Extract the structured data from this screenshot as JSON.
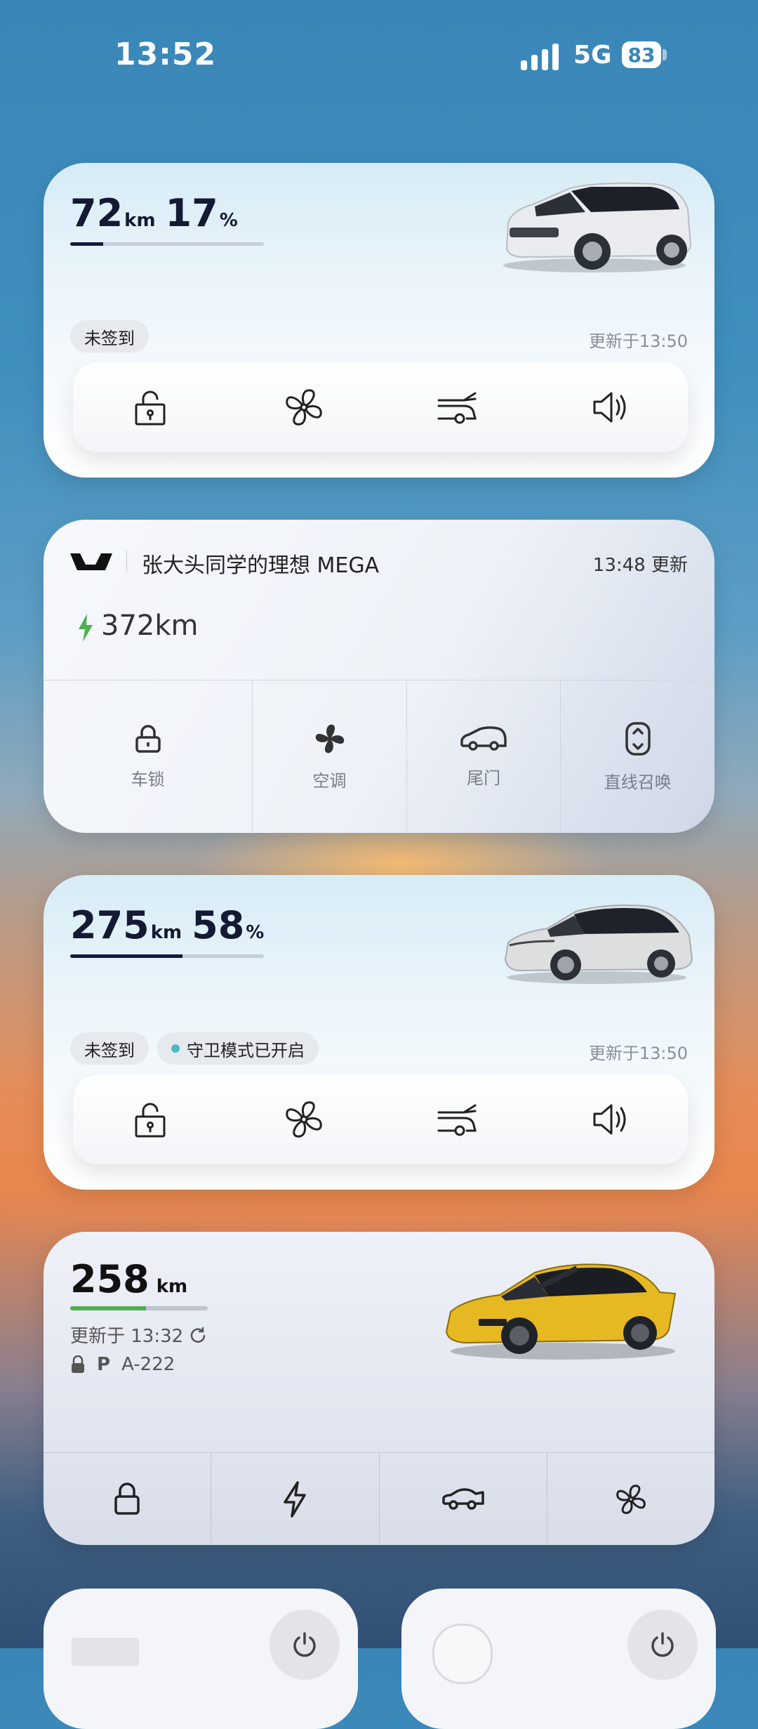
{
  "status_bar": {
    "time": "13:52",
    "network": "5G",
    "battery": "83"
  },
  "cards": [
    {
      "range_value": "72",
      "range_unit": "km",
      "battery_value": "17",
      "battery_unit": "%",
      "battery_level_fraction": 0.17,
      "badge": "未签到",
      "updated": "更新于13:50",
      "controls": [
        "lock-icon",
        "fan-icon",
        "tailgate-icon",
        "horn-icon"
      ]
    },
    {
      "title": "张大头同学的理想 MEGA",
      "updated": "13:48 更新",
      "range": "372km",
      "controls": [
        {
          "label": "车锁",
          "icon": "lock-icon"
        },
        {
          "label": "空调",
          "icon": "fan-icon"
        },
        {
          "label": "尾门",
          "icon": "car-rear-icon"
        },
        {
          "label": "直线召唤",
          "icon": "summon-icon"
        }
      ]
    },
    {
      "range_value": "275",
      "range_unit": "km",
      "battery_value": "58",
      "battery_unit": "%",
      "battery_level_fraction": 0.58,
      "badge": "未签到",
      "sentry_badge": "守卫模式已开启",
      "updated": "更新于13:50",
      "controls": [
        "lock-icon",
        "fan-icon",
        "tailgate-icon",
        "horn-icon"
      ]
    },
    {
      "range_value": "258",
      "range_unit": "km",
      "battery_level_fraction": 0.55,
      "updated": "更新于 13:32",
      "gear": "P",
      "plate": "A-222",
      "controls": [
        "lock-icon",
        "bolt-icon",
        "trunk-icon",
        "fan-icon"
      ]
    }
  ],
  "colors": {
    "accent_green": "#4caf50",
    "dark_navy": "#131a3a",
    "sentry_dot": "#4db8c0"
  }
}
